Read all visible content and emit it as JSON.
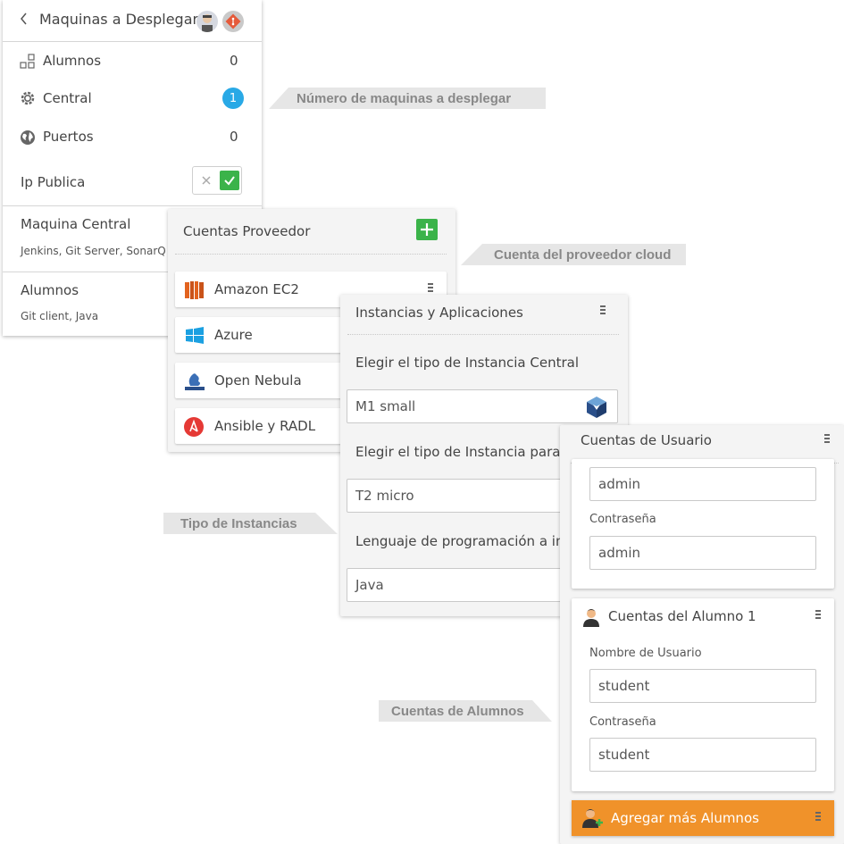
{
  "left_panel": {
    "title": "Maquinas a Desplegar",
    "rows": [
      {
        "label": "Alumnos",
        "value": "0"
      },
      {
        "label": "Central",
        "value": "1"
      },
      {
        "label": "Puertos",
        "value": "0"
      }
    ],
    "ip_publica_label": "Ip Publica",
    "ip_publica_enabled": true,
    "central_section": {
      "title": "Maquina Central",
      "subtitle": "Jenkins, Git Server, SonarQ"
    },
    "alumnos_section": {
      "title": "Alumnos",
      "subtitle": "Git client, Java"
    }
  },
  "providers_panel": {
    "title": "Cuentas Proveedor",
    "items": [
      {
        "label": "Amazon EC2",
        "icon": "amazon-ec2-icon"
      },
      {
        "label": "Azure",
        "icon": "windows-azure-icon"
      },
      {
        "label": "Open Nebula",
        "icon": "open-nebula-icon"
      },
      {
        "label": "Ansible y RADL",
        "icon": "ansible-icon"
      }
    ]
  },
  "instances_panel": {
    "title": "Instancias y Aplicaciones",
    "central_label": "Elegir el tipo de Instancia Central",
    "central_value": "M1 small",
    "alumnos_label": "Elegir el tipo de Instancia para al",
    "alumnos_value": "T2 micro",
    "language_label": "Lenguaje de programación a imp",
    "language_value": "Java"
  },
  "accounts_panel": {
    "title": "Cuentas de Usuario",
    "admin_user_value": "admin",
    "admin_password_label": "Contraseña",
    "admin_password_value": "admin",
    "student_card_title": "Cuentas del Alumno 1",
    "student_user_label": "Nombre de Usuario",
    "student_user_value": "student",
    "student_password_label": "Contraseña",
    "student_password_value": "student",
    "add_button_label": "Agregar más Alumnos"
  },
  "callouts": {
    "machines": "Número de maquinas a desplegar",
    "provider": "Cuenta del proveedor cloud",
    "instances": "Tipo de Instancias",
    "students": "Cuentas de Alumnos"
  },
  "colors": {
    "badge_blue": "#29a9e6",
    "check_green": "#3bb34a",
    "add_orange": "#f0922a",
    "aws_orange": "#e2631f",
    "azure_blue": "#1ba0e1",
    "ansible_red": "#e53935"
  }
}
